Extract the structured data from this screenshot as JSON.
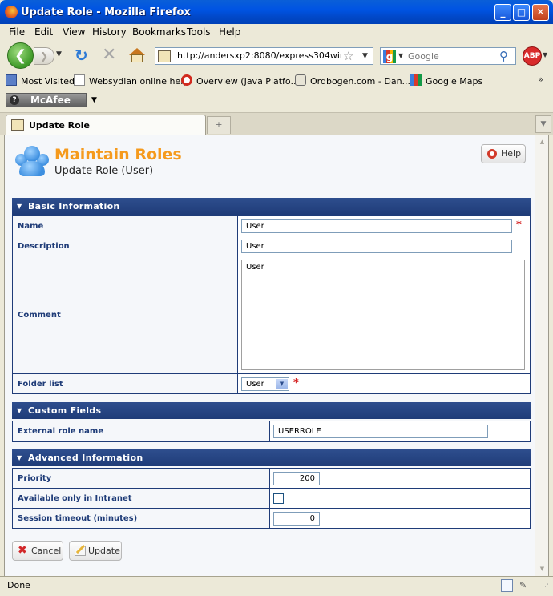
{
  "window": {
    "title": "Update Role - Mozilla Firefox"
  },
  "menu": [
    "File",
    "Edit",
    "View",
    "History",
    "Bookmarks",
    "Tools",
    "Help"
  ],
  "nav": {
    "url": "http://andersxp2:8080/express304win/sit",
    "search_placeholder": "Google",
    "abp_label": "ABP"
  },
  "bookmarks": [
    "Most Visited",
    "Websydian online help",
    "Overview (Java Platfo...",
    "Ordbogen.com - Dan...",
    "Google Maps"
  ],
  "mcafee": {
    "label": "McAfee"
  },
  "tab": {
    "label": "Update Role"
  },
  "page": {
    "title": "Maintain Roles",
    "subtitle": "Update Role (User)",
    "help_label": "Help"
  },
  "basic": {
    "header": "Basic Information",
    "name_label": "Name",
    "name_value": "User",
    "description_label": "Description",
    "description_value": "User",
    "comment_label": "Comment",
    "comment_value": "User",
    "folder_label": "Folder list",
    "folder_value": "User"
  },
  "custom": {
    "header": "Custom Fields",
    "external_label": "External role name",
    "external_value": "USERROLE"
  },
  "advanced": {
    "header": "Advanced Information",
    "priority_label": "Priority",
    "priority_value": "200",
    "intranet_label": "Available only in Intranet",
    "intranet_checked": false,
    "timeout_label": "Session timeout (minutes)",
    "timeout_value": "0"
  },
  "actions": {
    "cancel_label": "Cancel",
    "update_label": "Update"
  },
  "status": {
    "text": "Done"
  },
  "required_marker": "*",
  "colors": {
    "accent": "#F59A1D",
    "section_header": "#1F3C78",
    "required": "#D42020"
  }
}
